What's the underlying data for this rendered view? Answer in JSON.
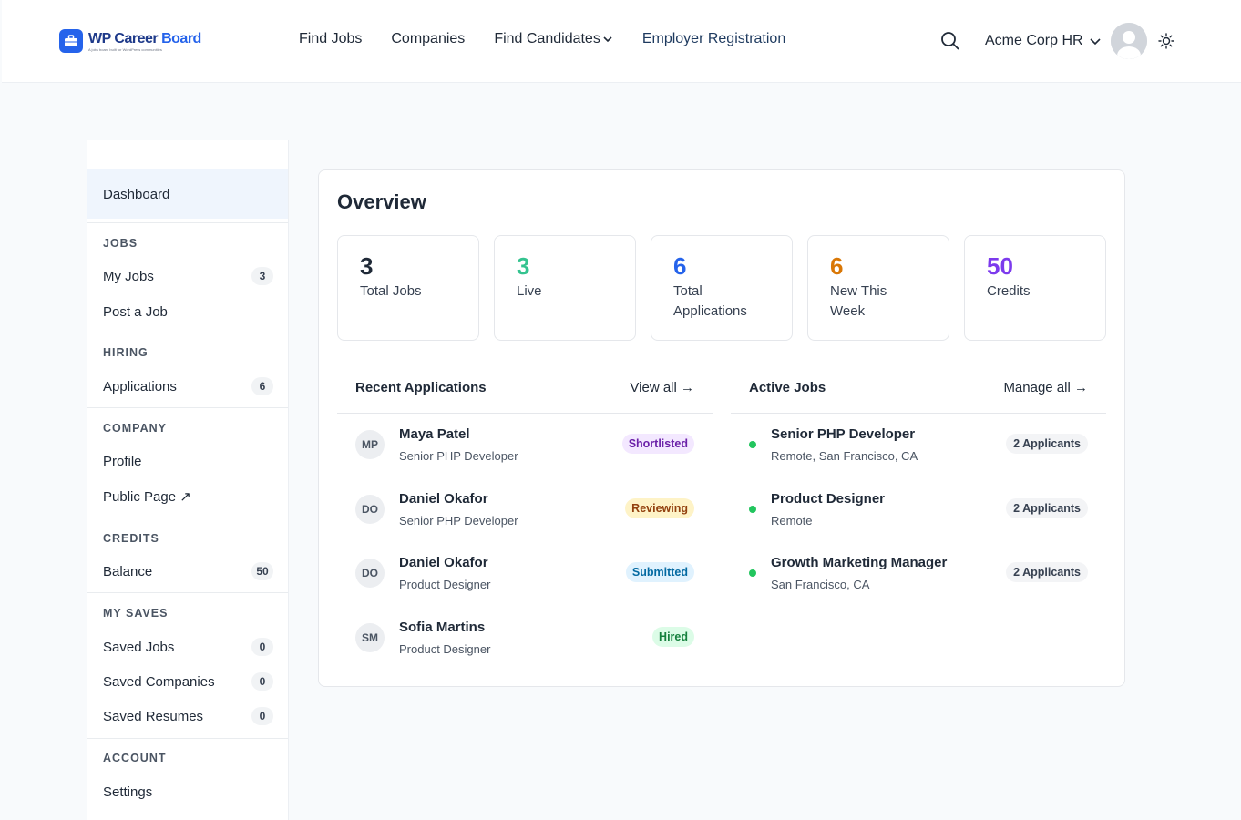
{
  "header": {
    "brand": "WP Career Board",
    "brand_primary": "WP Career",
    "brand_accent": "Board",
    "brand_tagline": "A jobs board built for WordPress communities",
    "nav": [
      "Find Jobs",
      "Companies",
      "Find Candidates",
      "Employer Registration"
    ],
    "user_name": "Acme Corp HR"
  },
  "sidebar": {
    "dashboard": "Dashboard",
    "sections": [
      {
        "heading": "JOBS",
        "items": [
          {
            "label": "My Jobs",
            "count": "3"
          },
          {
            "label": "Post a Job"
          }
        ]
      },
      {
        "heading": "HIRING",
        "items": [
          {
            "label": "Applications",
            "count": "6"
          }
        ]
      },
      {
        "heading": "COMPANY",
        "items": [
          {
            "label": "Profile"
          },
          {
            "label": "Public Page ↗"
          }
        ]
      },
      {
        "heading": "CREDITS",
        "items": [
          {
            "label": "Balance",
            "count": "50"
          }
        ]
      },
      {
        "heading": "MY SAVES",
        "items": [
          {
            "label": "Saved Jobs",
            "count": "0"
          },
          {
            "label": "Saved Companies",
            "count": "0"
          },
          {
            "label": "Saved Resumes",
            "count": "0"
          }
        ]
      },
      {
        "heading": "ACCOUNT",
        "items": [
          {
            "label": "Settings"
          }
        ]
      }
    ]
  },
  "overview": {
    "title": "Overview",
    "stats": [
      {
        "value": "3",
        "label": "Total Jobs",
        "color": "#1f2937"
      },
      {
        "value": "3",
        "label": "Live",
        "color": "#34c38f"
      },
      {
        "value": "6",
        "label": "Total Applications",
        "color": "#2563eb"
      },
      {
        "value": "6",
        "label": "New This Week",
        "color": "#d97706"
      },
      {
        "value": "50",
        "label": "Credits",
        "color": "#7c3aed"
      }
    ]
  },
  "recent_applications": {
    "title": "Recent Applications",
    "link": "View all →",
    "rows": [
      {
        "initials": "MP",
        "name": "Maya Patel",
        "role": "Senior PHP Developer",
        "status": "Shortlisted",
        "bg": "#f3e8ff",
        "fg": "#6b21a8"
      },
      {
        "initials": "DO",
        "name": "Daniel Okafor",
        "role": "Senior PHP Developer",
        "status": "Reviewing",
        "bg": "#fef3c7",
        "fg": "#92400e"
      },
      {
        "initials": "DO",
        "name": "Daniel Okafor",
        "role": "Product Designer",
        "status": "Submitted",
        "bg": "#e0f2fe",
        "fg": "#0369a1"
      },
      {
        "initials": "SM",
        "name": "Sofia Martins",
        "role": "Product Designer",
        "status": "Hired",
        "bg": "#dcfce7",
        "fg": "#15803d"
      }
    ]
  },
  "active_jobs": {
    "title": "Active Jobs",
    "link": "Manage all →",
    "rows": [
      {
        "title": "Senior PHP Developer",
        "location": "Remote, San Francisco, CA",
        "applicants": "2 Applicants"
      },
      {
        "title": "Product Designer",
        "location": "Remote",
        "applicants": "2 Applicants"
      },
      {
        "title": "Growth Marketing Manager",
        "location": "San Francisco, CA",
        "applicants": "2 Applicants"
      }
    ]
  }
}
